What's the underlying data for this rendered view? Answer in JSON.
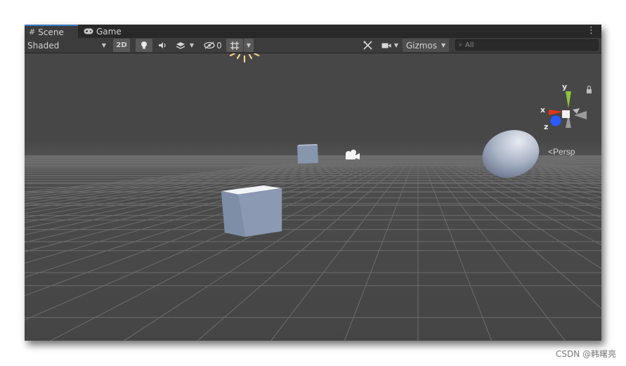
{
  "tabs": [
    {
      "label": "Scene",
      "icon": "grid-icon",
      "active": true
    },
    {
      "label": "Game",
      "icon": "gamepad-icon",
      "active": false
    }
  ],
  "toolbar": {
    "shading_mode": "Shaded",
    "toggle_2d_label": "2D",
    "hidden_count": "0",
    "gizmos_label": "Gizmos",
    "search_placeholder": "All"
  },
  "scene": {
    "camera_mode": "Persp",
    "gizmo_axes": {
      "x": "x",
      "y": "y",
      "z": "z"
    },
    "colors": {
      "x_axis": "#e0361c",
      "y_axis": "#8ac83a",
      "z_axis": "#2a5bff",
      "background": "#484848",
      "grid": "#6e6e6e"
    }
  },
  "watermark": "CSDN @韩曙亮"
}
